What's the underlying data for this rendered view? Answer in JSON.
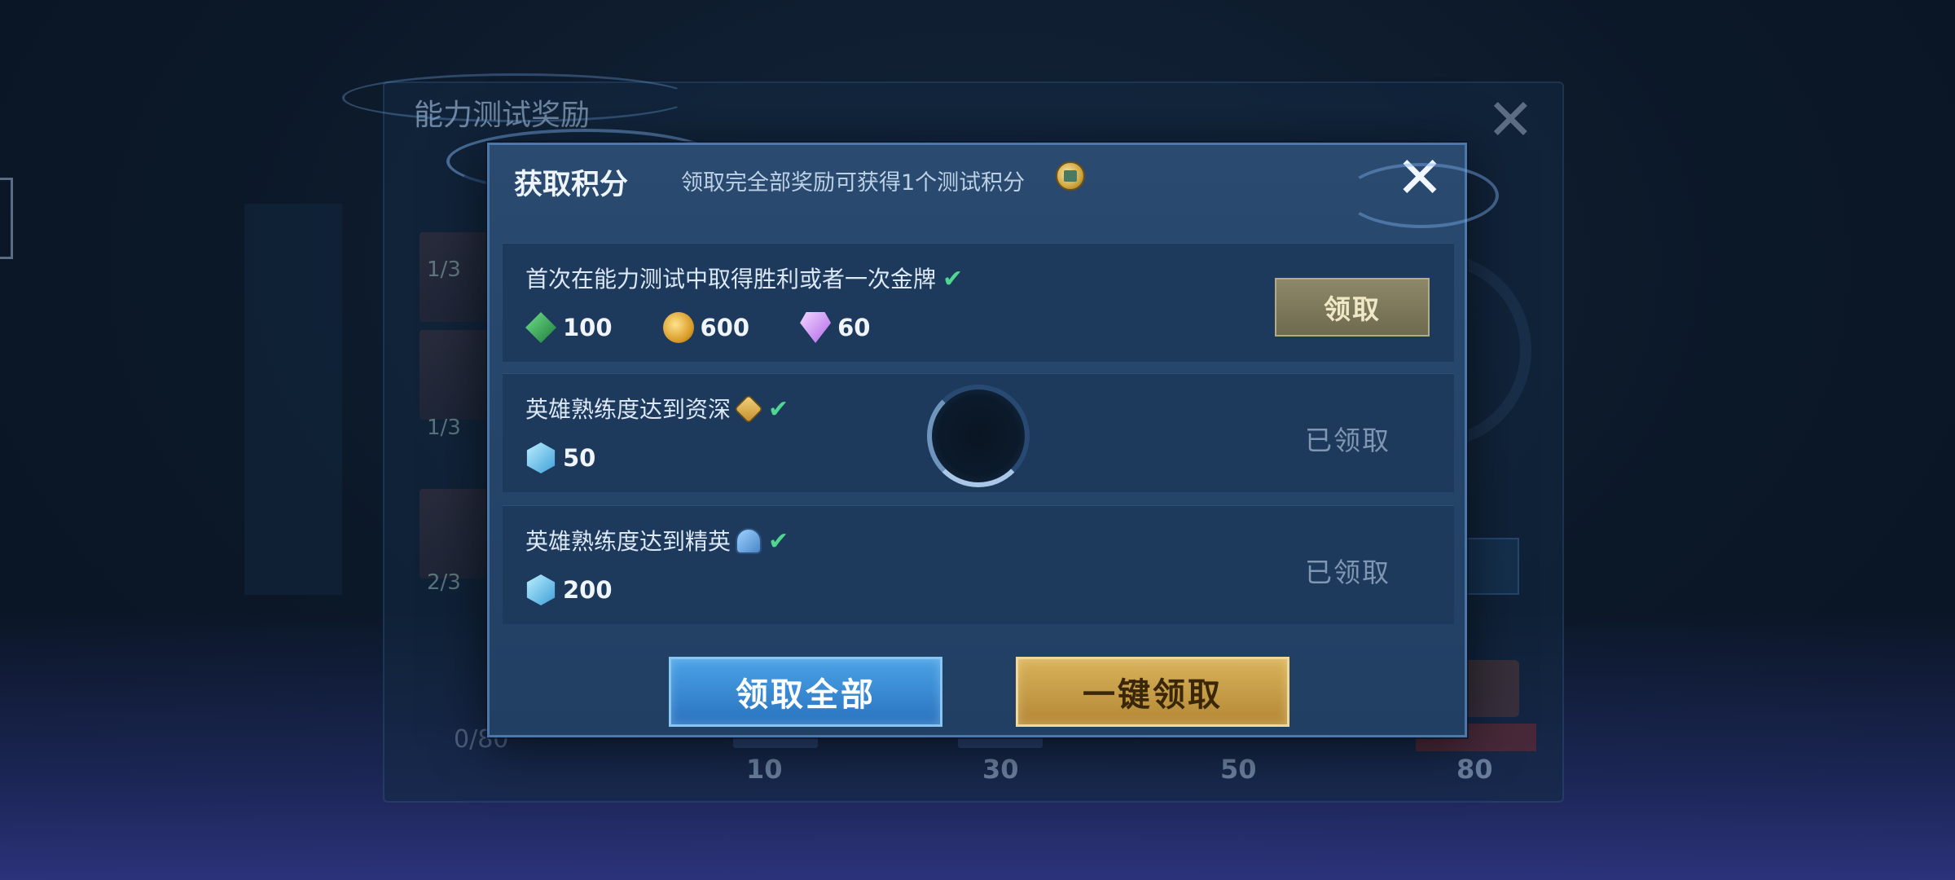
{
  "background": {
    "panel_title": "能力测试奖励",
    "progress": "0/80",
    "row_fractions": [
      "1/3",
      "1/3",
      "2/3"
    ],
    "ticks": [
      "10",
      "30",
      "50",
      "80"
    ]
  },
  "modal": {
    "title": "获取积分",
    "subtitle": "领取完全部奖励可获得1个测试积分",
    "tasks": [
      {
        "title": "首次在能力测试中取得胜利或者一次金牌",
        "completed": true,
        "rewards": [
          {
            "icon": "green-gem-icon",
            "value": "100"
          },
          {
            "icon": "gold-coin-icon",
            "value": "600"
          },
          {
            "icon": "purple-diamond-icon",
            "value": "60"
          }
        ],
        "status": "claimable",
        "button_label": "领取"
      },
      {
        "title": "英雄熟练度达到资深",
        "completed": true,
        "rewards": [
          {
            "icon": "blue-crystal-icon",
            "value": "50"
          }
        ],
        "status": "claimed",
        "status_label": "已领取"
      },
      {
        "title": "英雄熟练度达到精英",
        "completed": true,
        "rewards": [
          {
            "icon": "blue-crystal-icon",
            "value": "200"
          }
        ],
        "status": "claimed",
        "status_label": "已领取"
      }
    ],
    "claim_all_label": "领取全部",
    "one_click_label": "一键领取"
  },
  "colors": {
    "check": "#4fd68f",
    "claim_all": "#2a73bf",
    "one_click": "#d9b25a"
  }
}
